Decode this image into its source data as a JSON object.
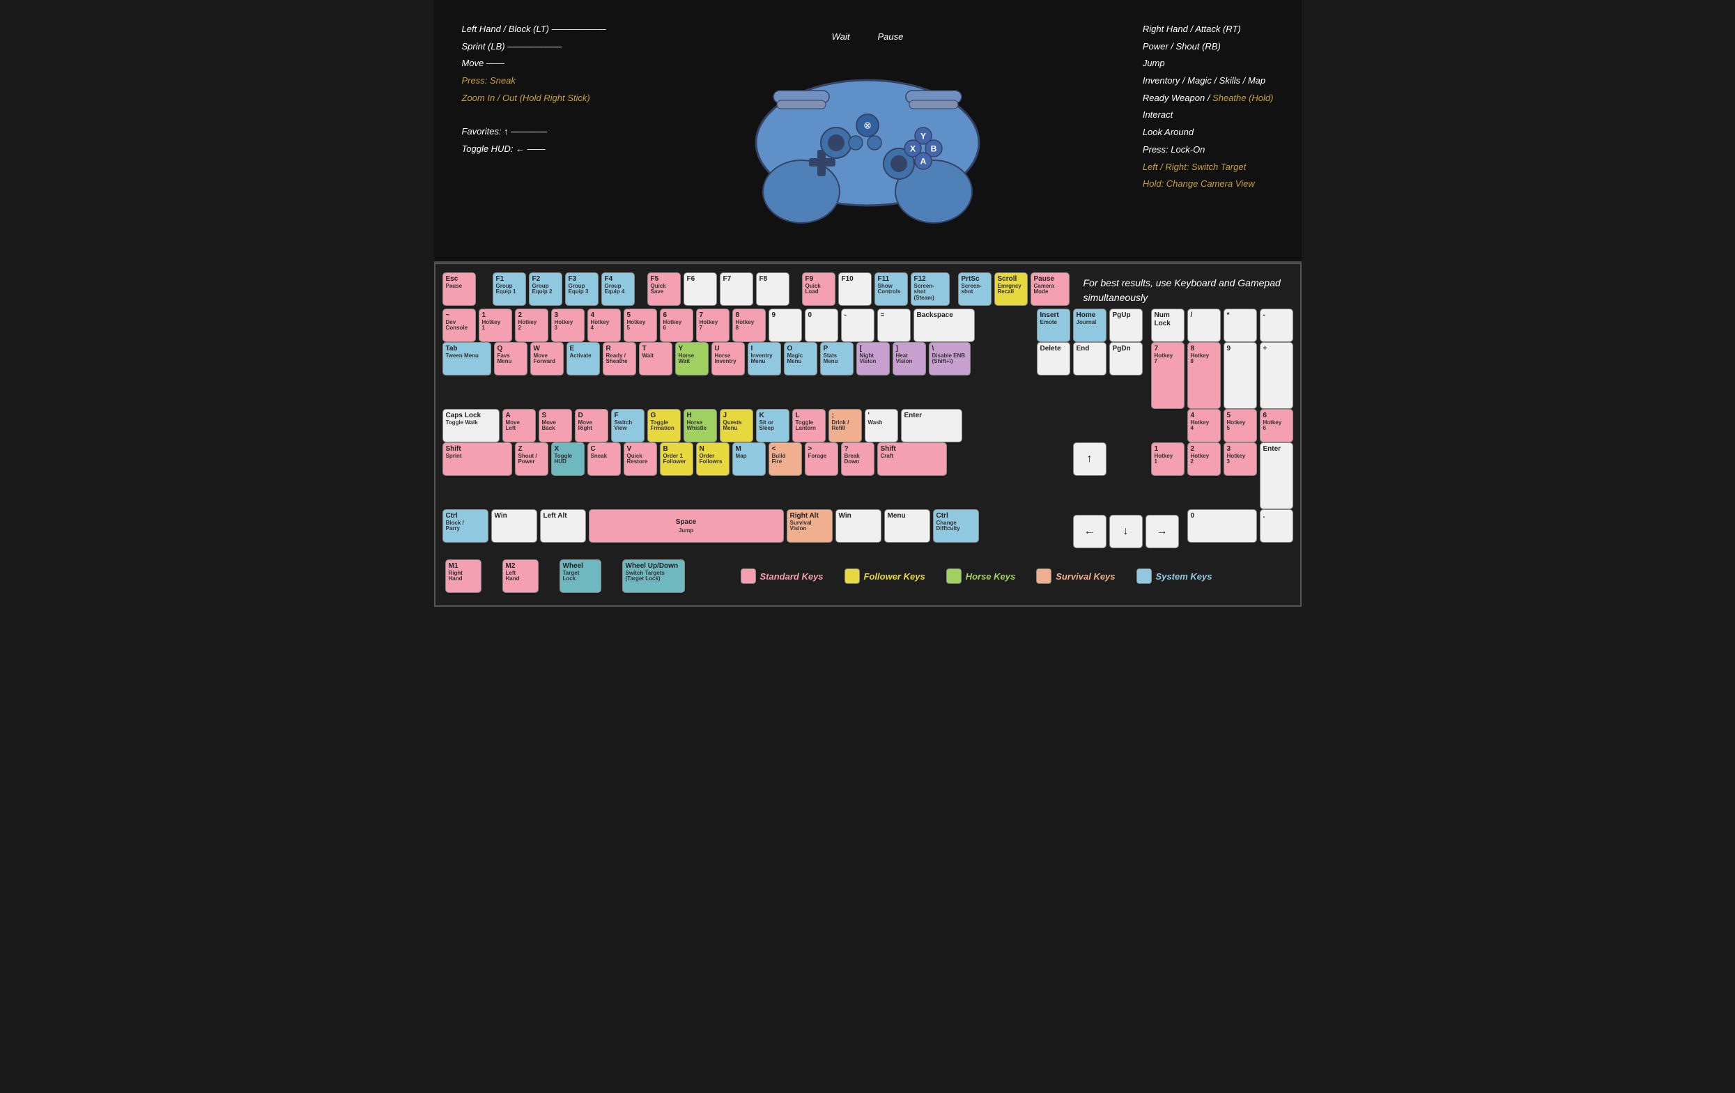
{
  "controller": {
    "labels_left": [
      {
        "text": "Left Hand / Block (LT)",
        "color": "white"
      },
      {
        "text": "Sprint (LB)",
        "color": "white"
      },
      {
        "text": "Move",
        "color": "white"
      },
      {
        "text": "Press: Sneak",
        "color": "gold"
      },
      {
        "text": "Zoom In / Out (Hold Right Stick)",
        "color": "gold"
      },
      {
        "text": "",
        "color": "white"
      },
      {
        "text": "Favorites: ↑",
        "color": "white"
      },
      {
        "text": "Toggle HUD: ←",
        "color": "white"
      }
    ],
    "labels_right": [
      {
        "text": "Right Hand / Attack (RT)",
        "color": "white"
      },
      {
        "text": "Power / Shout (RB)",
        "color": "white"
      },
      {
        "text": "Jump",
        "color": "white"
      },
      {
        "text": "Inventory / Magic / Skills / Map",
        "color": "white"
      },
      {
        "text": "Ready Weapon / Sheathe (Hold)",
        "color": "white"
      },
      {
        "text": "Interact",
        "color": "white"
      },
      {
        "text": "Look Around",
        "color": "white"
      },
      {
        "text": "Press: Lock-On",
        "color": "white"
      },
      {
        "text": "Left / Right: Switch Target",
        "color": "white"
      },
      {
        "text": "Hold: Change Camera View",
        "color": "white"
      }
    ],
    "top_labels": [
      "Wait",
      "Pause"
    ]
  },
  "info_text": "For best results, use Keyboard\nand Gamepad simultaneously",
  "legend": {
    "standard_label": "Standard Keys",
    "follower_label": "Follower Keys",
    "horse_label": "Horse Keys",
    "survival_label": "Survival Keys",
    "system_label": "System Keys"
  },
  "rows": {
    "fn_row": [
      {
        "main": "Esc",
        "sub": "Pause",
        "color": "pink",
        "w": 44
      },
      {
        "main": "",
        "sub": "",
        "color": "none",
        "w": 22
      },
      {
        "main": "F1",
        "sub": "Group\nEquip 1",
        "color": "blue",
        "w": 44
      },
      {
        "main": "F2",
        "sub": "Group\nEquip 2",
        "color": "blue",
        "w": 44
      },
      {
        "main": "F3",
        "sub": "Group\nEquip 3",
        "color": "blue",
        "w": 44
      },
      {
        "main": "F4",
        "sub": "Group\nEquip 4",
        "color": "blue",
        "w": 44
      },
      {
        "main": "",
        "sub": "",
        "color": "none",
        "w": 11
      },
      {
        "main": "F5",
        "sub": "Quick\nSave",
        "color": "pink",
        "w": 44
      },
      {
        "main": "F6",
        "sub": "",
        "color": "white",
        "w": 44
      },
      {
        "main": "F7",
        "sub": "",
        "color": "white",
        "w": 44
      },
      {
        "main": "F8",
        "sub": "",
        "color": "white",
        "w": 44
      },
      {
        "main": "",
        "sub": "",
        "color": "none",
        "w": 11
      },
      {
        "main": "F9",
        "sub": "Quick\nLoad",
        "color": "pink",
        "w": 44
      },
      {
        "main": "F10",
        "sub": "",
        "color": "white",
        "w": 44
      },
      {
        "main": "F11",
        "sub": "Show\nControls",
        "color": "blue",
        "w": 44
      },
      {
        "main": "F12",
        "sub": "Screen-\nshot\n(Steam)",
        "color": "blue",
        "w": 44
      }
    ]
  }
}
